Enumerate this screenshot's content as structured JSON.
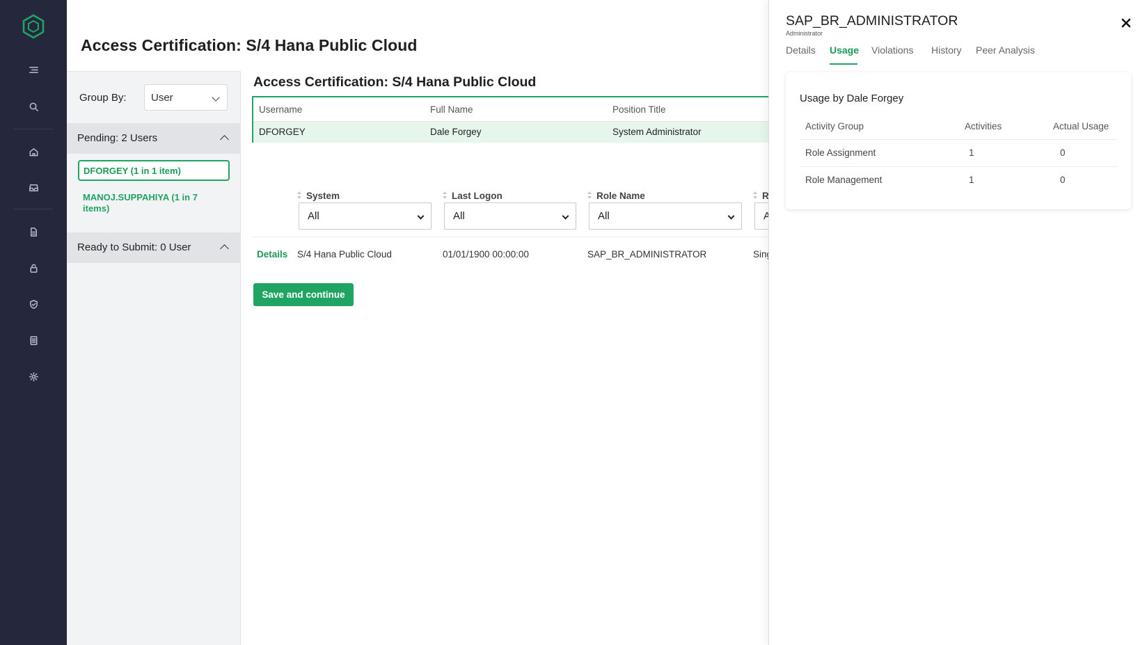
{
  "page": {
    "title": "Access Certification: S/4 Hana Public Cloud"
  },
  "sidebar": {
    "icons": [
      "menu-icon",
      "search-icon",
      "home-icon",
      "inbox-icon",
      "document-icon",
      "lock-icon",
      "shield-check-icon",
      "report-icon",
      "settings-icon"
    ]
  },
  "group_panel": {
    "group_by_label": "Group By:",
    "group_by_value": "User",
    "pending_header": "Pending: 2 Users",
    "users": [
      {
        "label": "DFORGEY (1 in 1 item)"
      },
      {
        "label": "MANOJ.SUPPAHIYA (1 in 7 items)"
      }
    ],
    "ready_header": "Ready to Submit: 0 User"
  },
  "main": {
    "title": "Access Certification: S/4 Hana Public Cloud",
    "user_table": {
      "headers": [
        "Username",
        "Full Name",
        "Position Title"
      ],
      "row": [
        "DFORGEY",
        "Dale Forgey",
        "System Administrator"
      ]
    },
    "filters": [
      {
        "label": "System",
        "value": "All"
      },
      {
        "label": "Last Logon",
        "value": "All"
      },
      {
        "label": "Role Name",
        "value": "All"
      },
      {
        "label": "R",
        "value": "A"
      }
    ],
    "row": {
      "details_link": "Details",
      "system": "S/4 Hana Public Cloud",
      "last_logon": "01/01/1900 00:00:00",
      "role_name": "SAP_BR_ADMINISTRATOR",
      "extra": "Sing"
    },
    "save_button": "Save and continue"
  },
  "drawer": {
    "title": "SAP_BR_ADMINISTRATOR",
    "subtitle": "Administrator",
    "tabs": [
      "Details",
      "Usage",
      "Violations",
      "History",
      "Peer Analysis"
    ],
    "active_tab": "Usage",
    "usage": {
      "title": "Usage by Dale Forgey",
      "headers": [
        "Activity Group",
        "Activities",
        "Actual Usage"
      ],
      "rows": [
        [
          "Role Assignment",
          "1",
          "0"
        ],
        [
          "Role Management",
          "1",
          "0"
        ]
      ]
    }
  },
  "colors": {
    "accent": "#1fa463",
    "rail": "#25283d",
    "panel": "#f2f3f5"
  }
}
